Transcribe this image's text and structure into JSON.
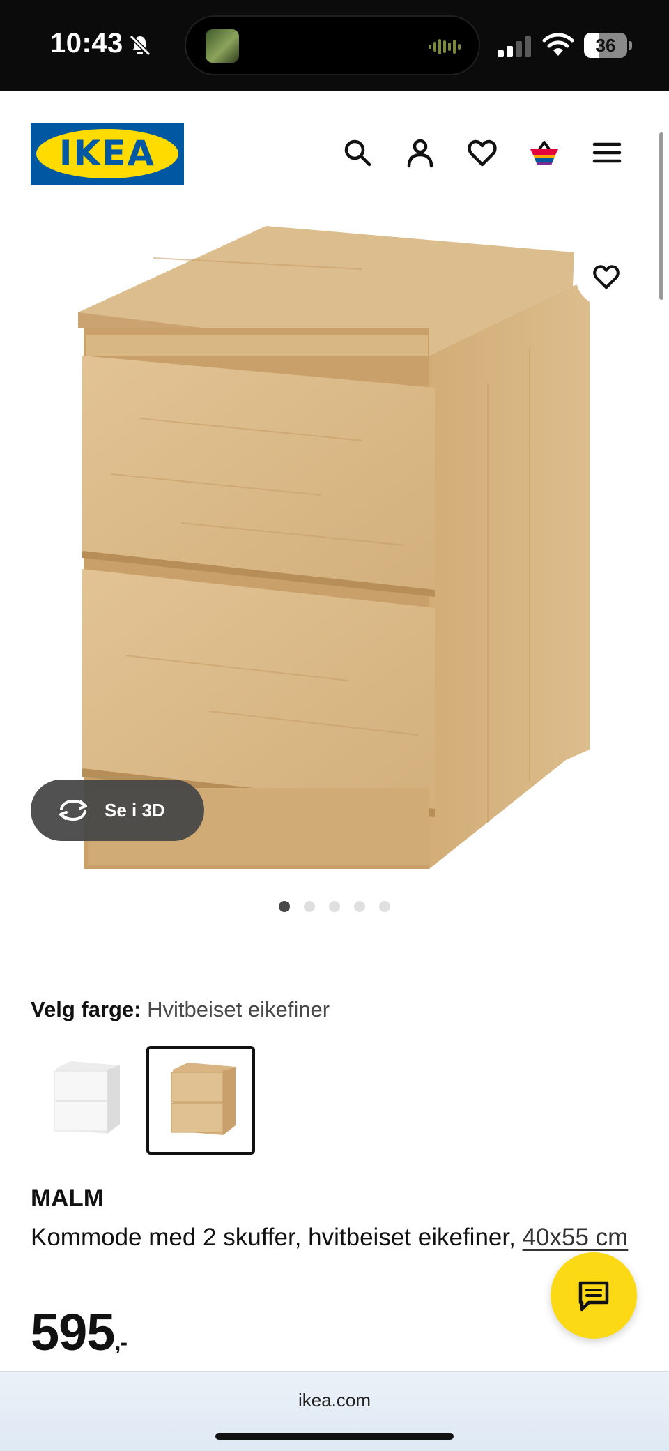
{
  "status_bar": {
    "time": "10:43",
    "battery": "36",
    "battery_level": 0.36
  },
  "header": {
    "logo": "IKEA",
    "icons": [
      "search-icon",
      "account-icon",
      "heart-icon",
      "basket-icon",
      "menu-icon"
    ]
  },
  "gallery": {
    "view_3d_label": "Se i 3D",
    "image_count": 5,
    "active_index": 0
  },
  "product": {
    "color_label": "Velg farge:",
    "color_value": "Hvitbeiset eikefiner",
    "swatches": [
      {
        "name": "white",
        "selected": false,
        "color": "#f4f4f4"
      },
      {
        "name": "oak",
        "selected": true,
        "color": "#d9b983"
      }
    ],
    "name": "MALM",
    "description": "Kommode med 2 skuffer, hvitbeiset eikefiner,",
    "size_link": "40x55 cm",
    "price": "595",
    "price_suffix": ",-"
  },
  "colors": {
    "brand_blue": "#0058a3",
    "brand_yellow": "#ffdb00",
    "chat_yellow": "#fbd914"
  },
  "browser": {
    "url": "ikea.com"
  }
}
